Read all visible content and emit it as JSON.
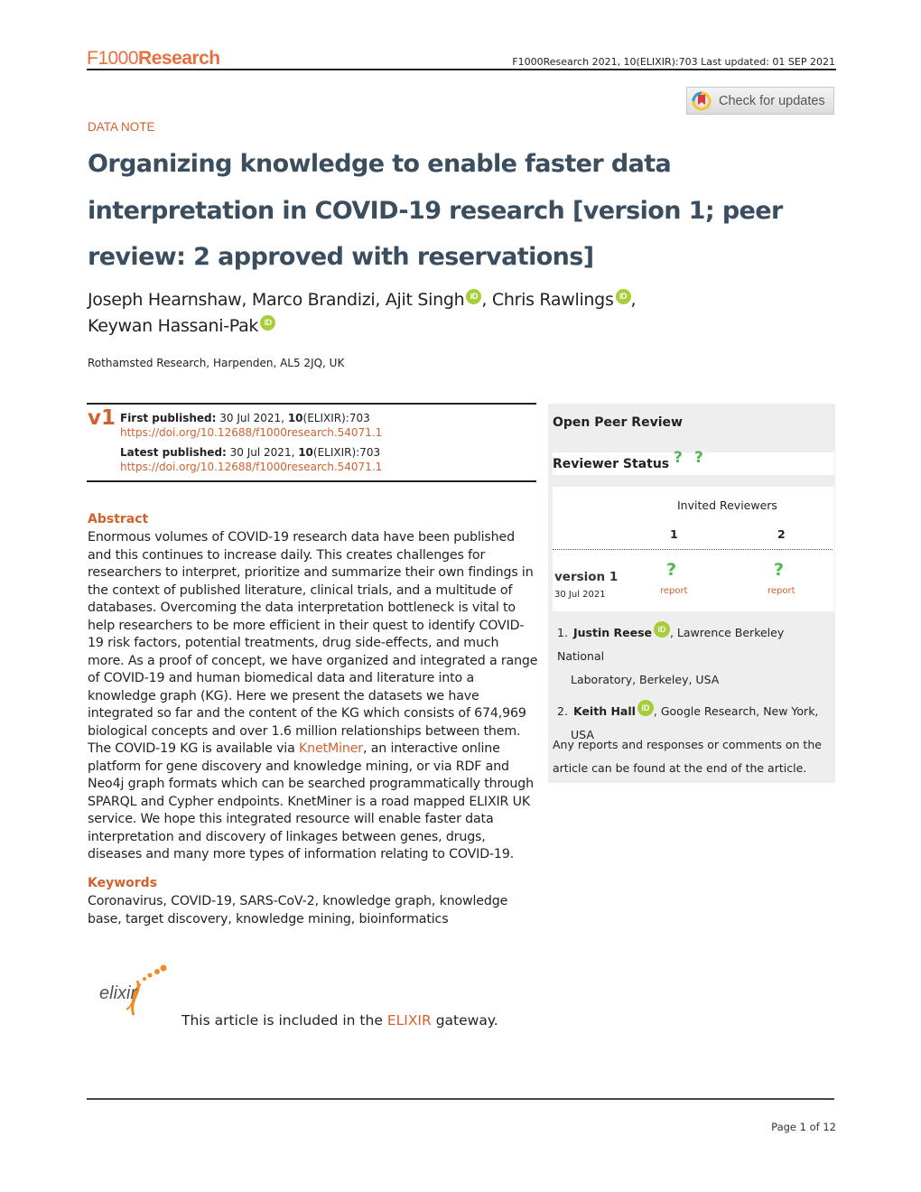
{
  "header": {
    "logo_prefix": "F1000",
    "logo_suffix": "Research",
    "citation": "F1000Research 2021, 10(ELIXIR):703 Last updated: 01 SEP 2021",
    "check_updates_label": "Check for updates"
  },
  "article": {
    "type": "DATA NOTE",
    "title": "Organizing knowledge to enable faster data interpretation in COVID-19 research",
    "version_note": "[version 1; peer review: 2 approved with reservations]",
    "authors": [
      {
        "name": "Joseph Hearnshaw",
        "orcid": false,
        "sep": ", "
      },
      {
        "name": "Marco Brandizi",
        "orcid": false,
        "sep": ", "
      },
      {
        "name": "Ajit Singh",
        "orcid": true,
        "sep": ", "
      },
      {
        "name": "Chris Rawlings",
        "orcid": true,
        "sep": ","
      },
      {
        "name": "Keywan Hassani-Pak",
        "orcid": true,
        "sep": ""
      }
    ],
    "orcid_label": "iD",
    "affiliation": "Rothamsted Research, Harpenden, AL5 2JQ, UK"
  },
  "publication": {
    "version_badge": "v1",
    "first_label": "First published:",
    "first_date": " 30 Jul 2021, ",
    "first_vol": "10",
    "first_issue": "(ELIXIR):703",
    "first_doi": "https://doi.org/10.12688/f1000research.54071.1",
    "latest_label": "Latest published:",
    "latest_date": " 30 Jul 2021, ",
    "latest_vol": "10",
    "latest_issue": "(ELIXIR):703",
    "latest_doi": "https://doi.org/10.12688/f1000research.54071.1"
  },
  "abstract": {
    "heading": "Abstract",
    "text_before_link": "Enormous volumes of COVID-19 research data have been published and this continues to increase daily. This creates challenges for researchers to interpret, prioritize and summarize their own findings in the context of published literature, clinical trials, and a multitude of databases. Overcoming the data interpretation bottleneck is vital to help researchers to be more efficient in their quest to identify COVID-19 risk factors, potential treatments, drug side-effects, and much more. As a proof of concept, we have organized and integrated a range of COVID-19 and human biomedical data and literature into a knowledge graph (KG). Here we present the datasets we have integrated so far and the content of the KG which consists of 674,969 biological concepts and over 1.6 million relationships between them. The COVID-19 KG is available via ",
    "link_text": "KnetMiner",
    "text_after_link": ", an interactive online platform for gene discovery and knowledge mining, or via RDF and Neo4j graph formats which can be searched programmatically through SPARQL and Cypher endpoints. KnetMiner is a road mapped ELIXIR UK service. We hope this integrated resource will enable faster data interpretation and discovery of linkages between genes, drugs, diseases and many more types of information relating to COVID-19."
  },
  "keywords": {
    "heading": "Keywords",
    "text": "Coronavirus, COVID-19, SARS-CoV-2, knowledge graph, knowledge base, target discovery, knowledge mining, bioinformatics"
  },
  "gateway": {
    "logo_text": "elixir",
    "before": "This article is included in the ",
    "link": "ELIXIR",
    "after": " gateway."
  },
  "peer_review": {
    "title": "Open Peer Review",
    "status_label": "Reviewer Status",
    "status_icons": [
      "?",
      "?"
    ],
    "invited_label": "Invited Reviewers",
    "columns": [
      "1",
      "2"
    ],
    "version_label": "version 1",
    "version_date": "30 Jul 2021",
    "row_icons": [
      "?",
      "?"
    ],
    "report_label": "report",
    "reviewers": [
      {
        "num": "1.",
        "name": "Justin Reese",
        "affil_line1": ", Lawrence Berkeley National",
        "affil_line2": "Laboratory, Berkeley, USA"
      },
      {
        "num": "2.",
        "name": "Keith Hall",
        "affil_line1": ", Google Research, New York,",
        "affil_line2": "USA"
      }
    ],
    "note": "Any reports and responses or comments on the article can be found at the end of the article."
  },
  "footer": {
    "page": "Page 1 of 12"
  },
  "colors": {
    "accent": "#d0622d",
    "title": "#3a4e5f",
    "orcid": "#a6ce39",
    "status_question": "#4cb84e",
    "panel_bg": "#eeeeee"
  }
}
